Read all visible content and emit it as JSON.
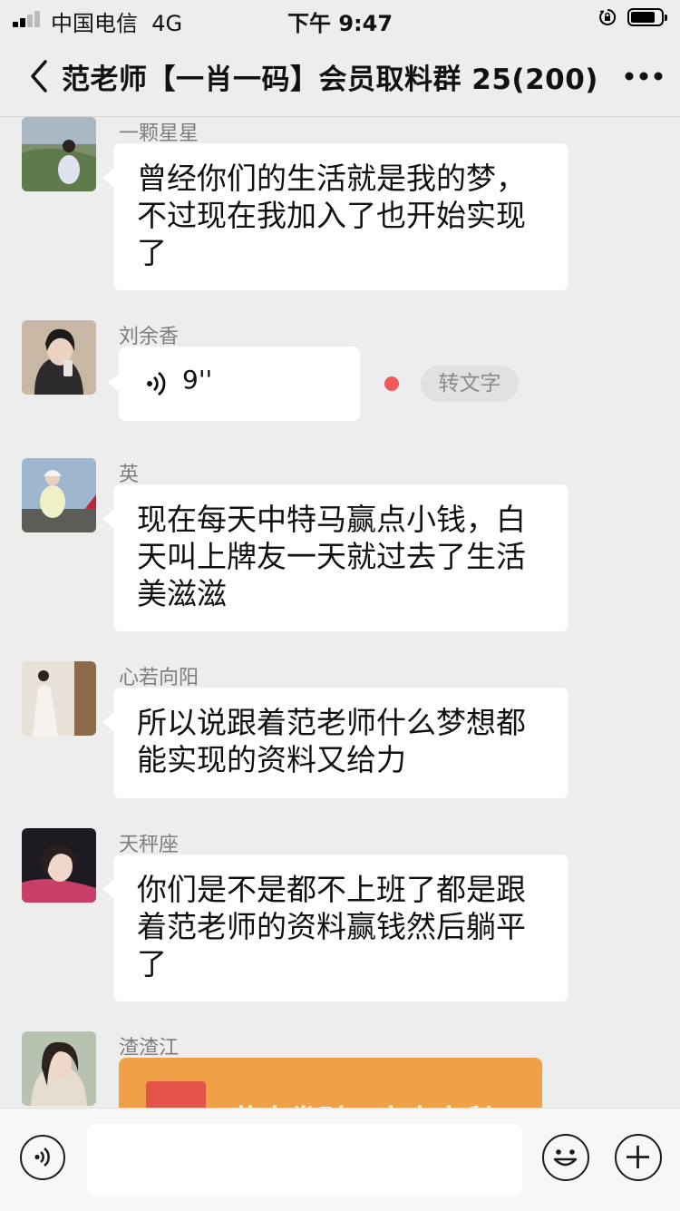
{
  "status_bar": {
    "carrier": "中国电信",
    "network": "4G",
    "time": "下午 9:47",
    "battery_level": 0.75
  },
  "nav": {
    "title": "范老师【一肖一码】会员取料群 25(200)"
  },
  "messages": [
    {
      "sender": "一颗星星",
      "text": "曾经你们的生活就是我的梦，不过现在我加入了也开始实现了"
    },
    {
      "sender": "刘余香",
      "voice_duration": "9''",
      "to_text_label": "转文字"
    },
    {
      "sender": "英",
      "text": "现在每天中特马赢点小钱，白天叫上牌友一天就过去了生活美滋滋"
    },
    {
      "sender": "心若向阳",
      "text": "所以说跟着范老师什么梦想都能实现的资料又给力"
    },
    {
      "sender": "天秤座",
      "text": "你们是不是都不上班了都是跟着范老师的资料赢钱然后躺平了"
    },
    {
      "sender": "渣渣江",
      "red_packet_text": "恭喜发财，大吉大利"
    }
  ],
  "colors": {
    "background": "#ededed",
    "bubble": "#ffffff",
    "red_packet": "#f0a047",
    "unread_dot": "#f05a5a"
  },
  "icons": {
    "back": "chevron-left-icon",
    "more": "more-dots-icon",
    "voice": "voice-icon",
    "emoji": "emoji-icon",
    "add": "plus-icon"
  }
}
